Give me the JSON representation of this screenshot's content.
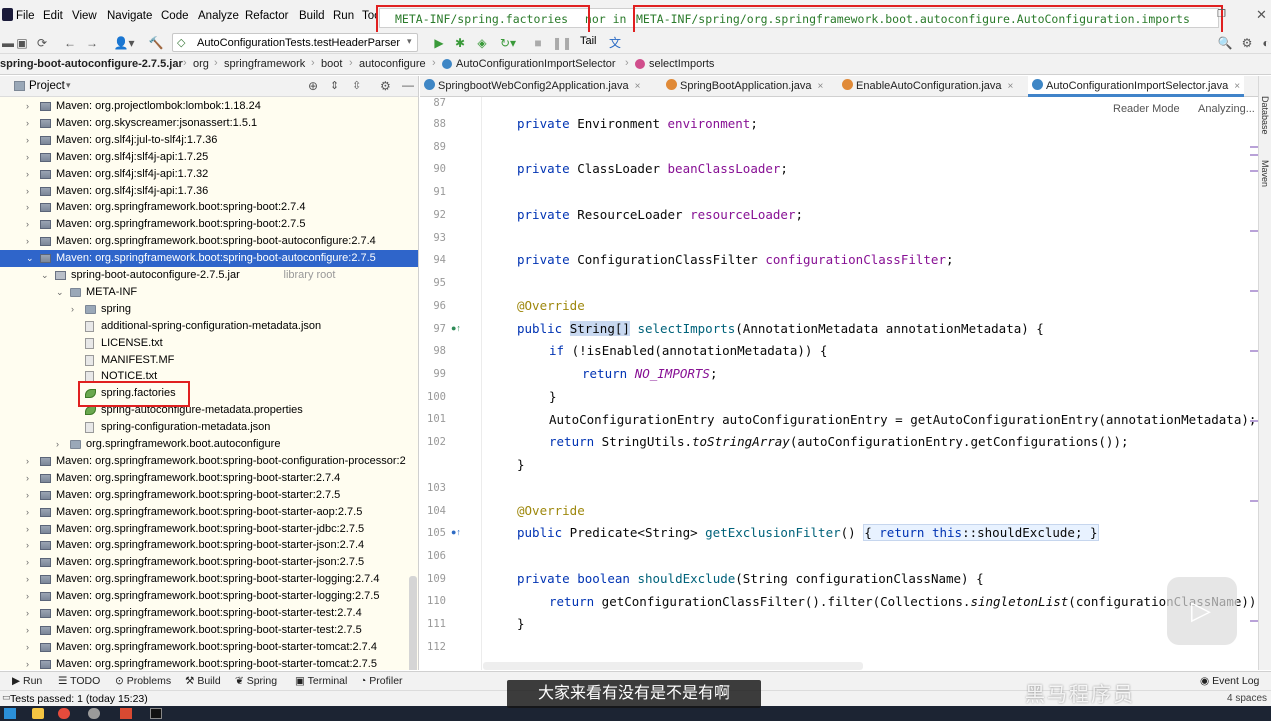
{
  "menubar": {
    "items": [
      "File",
      "Edit",
      "View",
      "Navigate",
      "Code",
      "Analyze",
      "Refactor",
      "Build",
      "Run",
      "Tools"
    ],
    "search_text_1": "META-INF/spring.factories",
    "search_text_mid": " nor in ",
    "search_text_2": "META-INF/spring/org.springframework.boot.autoconfigure.AutoConfiguration.imports"
  },
  "toolbar": {
    "run_config": "AutoConfigurationTests.testHeaderParser",
    "tail_label": "Tail"
  },
  "breadcrumb": [
    "spring-boot-autoconfigure-2.7.5.jar",
    "org",
    "springframework",
    "boot",
    "autoconfigure",
    "AutoConfigurationImportSelector",
    "selectImports"
  ],
  "project": {
    "title": "Project",
    "rows": [
      {
        "label": "Maven: org.projectlombok:lombok:1.18.24",
        "indent": 0,
        "kind": "lib",
        "arrow": "›"
      },
      {
        "label": "Maven: org.skyscreamer:jsonassert:1.5.1",
        "indent": 0,
        "kind": "lib",
        "arrow": "›"
      },
      {
        "label": "Maven: org.slf4j:jul-to-slf4j:1.7.36",
        "indent": 0,
        "kind": "lib",
        "arrow": "›"
      },
      {
        "label": "Maven: org.slf4j:slf4j-api:1.7.25",
        "indent": 0,
        "kind": "lib",
        "arrow": "›"
      },
      {
        "label": "Maven: org.slf4j:slf4j-api:1.7.32",
        "indent": 0,
        "kind": "lib",
        "arrow": "›"
      },
      {
        "label": "Maven: org.slf4j:slf4j-api:1.7.36",
        "indent": 0,
        "kind": "lib",
        "arrow": "›"
      },
      {
        "label": "Maven: org.springframework.boot:spring-boot:2.7.4",
        "indent": 0,
        "kind": "lib",
        "arrow": "›"
      },
      {
        "label": "Maven: org.springframework.boot:spring-boot:2.7.5",
        "indent": 0,
        "kind": "lib",
        "arrow": "›"
      },
      {
        "label": "Maven: org.springframework.boot:spring-boot-autoconfigure:2.7.4",
        "indent": 0,
        "kind": "lib",
        "arrow": "›"
      },
      {
        "label": "Maven: org.springframework.boot:spring-boot-autoconfigure:2.7.5",
        "indent": 0,
        "kind": "lib",
        "arrow": "⌄",
        "selected": true
      },
      {
        "label": "spring-boot-autoconfigure-2.7.5.jar",
        "suffix": "library root",
        "indent": 1,
        "kind": "jar",
        "arrow": "⌄"
      },
      {
        "label": "META-INF",
        "indent": 2,
        "kind": "folder",
        "arrow": "⌄"
      },
      {
        "label": "spring",
        "indent": 3,
        "kind": "folder",
        "arrow": "›"
      },
      {
        "label": "additional-spring-configuration-metadata.json",
        "indent": 3,
        "kind": "file",
        "arrow": ""
      },
      {
        "label": "LICENSE.txt",
        "indent": 3,
        "kind": "file",
        "arrow": ""
      },
      {
        "label": "MANIFEST.MF",
        "indent": 3,
        "kind": "file",
        "arrow": ""
      },
      {
        "label": "NOTICE.txt",
        "indent": 3,
        "kind": "file",
        "arrow": ""
      },
      {
        "label": "spring.factories",
        "indent": 3,
        "kind": "leaf",
        "arrow": ""
      },
      {
        "label": "spring-autoconfigure-metadata.properties",
        "indent": 3,
        "kind": "leaf",
        "arrow": ""
      },
      {
        "label": "spring-configuration-metadata.json",
        "indent": 3,
        "kind": "file",
        "arrow": ""
      },
      {
        "label": "org.springframework.boot.autoconfigure",
        "indent": 2,
        "kind": "folder",
        "arrow": "›"
      },
      {
        "label": "Maven: org.springframework.boot:spring-boot-configuration-processor:2",
        "indent": 0,
        "kind": "lib",
        "arrow": "›"
      },
      {
        "label": "Maven: org.springframework.boot:spring-boot-starter:2.7.4",
        "indent": 0,
        "kind": "lib",
        "arrow": "›"
      },
      {
        "label": "Maven: org.springframework.boot:spring-boot-starter:2.7.5",
        "indent": 0,
        "kind": "lib",
        "arrow": "›"
      },
      {
        "label": "Maven: org.springframework.boot:spring-boot-starter-aop:2.7.5",
        "indent": 0,
        "kind": "lib",
        "arrow": "›"
      },
      {
        "label": "Maven: org.springframework.boot:spring-boot-starter-jdbc:2.7.5",
        "indent": 0,
        "kind": "lib",
        "arrow": "›"
      },
      {
        "label": "Maven: org.springframework.boot:spring-boot-starter-json:2.7.4",
        "indent": 0,
        "kind": "lib",
        "arrow": "›"
      },
      {
        "label": "Maven: org.springframework.boot:spring-boot-starter-json:2.7.5",
        "indent": 0,
        "kind": "lib",
        "arrow": "›"
      },
      {
        "label": "Maven: org.springframework.boot:spring-boot-starter-logging:2.7.4",
        "indent": 0,
        "kind": "lib",
        "arrow": "›"
      },
      {
        "label": "Maven: org.springframework.boot:spring-boot-starter-logging:2.7.5",
        "indent": 0,
        "kind": "lib",
        "arrow": "›"
      },
      {
        "label": "Maven: org.springframework.boot:spring-boot-starter-test:2.7.4",
        "indent": 0,
        "kind": "lib",
        "arrow": "›"
      },
      {
        "label": "Maven: org.springframework.boot:spring-boot-starter-test:2.7.5",
        "indent": 0,
        "kind": "lib",
        "arrow": "›"
      },
      {
        "label": "Maven: org.springframework.boot:spring-boot-starter-tomcat:2.7.4",
        "indent": 0,
        "kind": "lib",
        "arrow": "›"
      },
      {
        "label": "Maven: org.springframework.boot:spring-boot-starter-tomcat:2.7.5",
        "indent": 0,
        "kind": "lib",
        "arrow": "›"
      }
    ]
  },
  "editor": {
    "tabs": [
      "SpringbootWebConfig2Application.java",
      "SpringBootApplication.java",
      "EnableAutoConfiguration.java",
      "AutoConfigurationImportSelector.java"
    ],
    "reader_mode": "Reader Mode",
    "analyzing": "Analyzing...",
    "line_numbers": [
      "87",
      "88",
      "89",
      "90",
      "91",
      "92",
      "93",
      "94",
      "95",
      "96",
      "97",
      "98",
      "99",
      "100",
      "101",
      "102",
      "103",
      "104",
      "105",
      "106",
      "109",
      "110",
      "111",
      "112",
      "113"
    ]
  },
  "tools": [
    "Run",
    "TODO",
    "Problems",
    "Build",
    "Spring",
    "Terminal",
    "Profiler",
    "Event Log"
  ],
  "status": {
    "tests": "Tests passed: 1 (today 15:23)",
    "right": "4 spaces"
  },
  "overlay": {
    "subtitle": "大家来看有没有是不是有啊",
    "watermark": "黑马程序员"
  },
  "right_strip": {
    "database": "Database",
    "maven": "Maven"
  },
  "colors": {
    "selection": "#2f65ca",
    "highlight_box": "#e02020",
    "keyword": "#0033b3",
    "field": "#871094",
    "annotation": "#9e880d"
  }
}
